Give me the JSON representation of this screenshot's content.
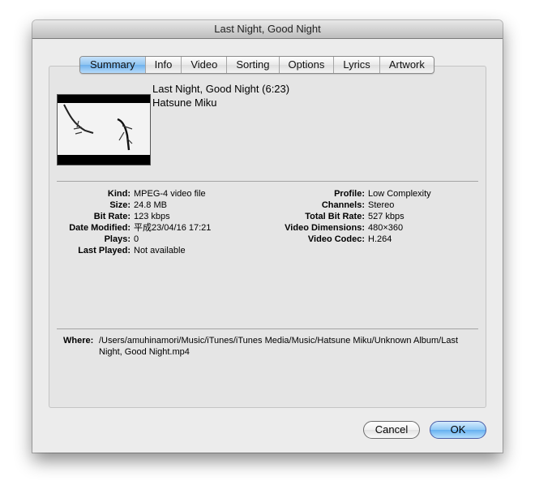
{
  "window": {
    "title": "Last Night, Good Night"
  },
  "tabs": [
    {
      "label": "Summary",
      "active": true
    },
    {
      "label": "Info",
      "active": false
    },
    {
      "label": "Video",
      "active": false
    },
    {
      "label": "Sorting",
      "active": false
    },
    {
      "label": "Options",
      "active": false
    },
    {
      "label": "Lyrics",
      "active": false
    },
    {
      "label": "Artwork",
      "active": false
    }
  ],
  "summary": {
    "title_line": "Last Night, Good Night (6:23)",
    "artist": "Hatsune Miku",
    "thumbnail_icon": "video-thumbnail-koi-fish"
  },
  "details_left": [
    {
      "label": "Kind:",
      "value": "MPEG-4 video file"
    },
    {
      "label": "Size:",
      "value": "24.8 MB"
    },
    {
      "label": "Bit Rate:",
      "value": "123 kbps"
    },
    {
      "label": "Date Modified:",
      "value": "平成23/04/16 17:21"
    },
    {
      "label": "Plays:",
      "value": "0"
    },
    {
      "label": "Last Played:",
      "value": "Not available"
    }
  ],
  "details_right": [
    {
      "label": "Profile:",
      "value": "Low Complexity"
    },
    {
      "label": "Channels:",
      "value": "Stereo"
    },
    {
      "label": "Total Bit Rate:",
      "value": "527 kbps"
    },
    {
      "label": "Video Dimensions:",
      "value": "480×360"
    },
    {
      "label": "Video Codec:",
      "value": "H.264"
    }
  ],
  "where": {
    "label": "Where:",
    "value": "/Users/amuhinamori/Music/iTunes/iTunes Media/Music/Hatsune Miku/Unknown Album/Last Night, Good Night.mp4"
  },
  "buttons": {
    "cancel": "Cancel",
    "ok": "OK"
  }
}
